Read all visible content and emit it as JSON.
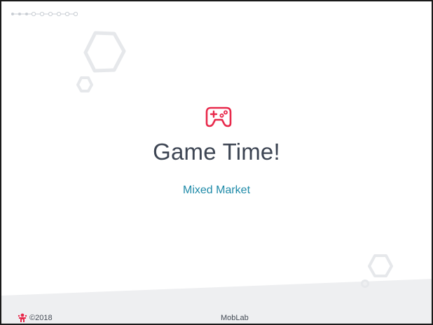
{
  "slide": {
    "title": "Game Time!",
    "subtitle": "Mixed Market"
  },
  "footer": {
    "copyright": "©2018",
    "brand": "MobLab"
  },
  "icons": {
    "main": "game-controller-icon",
    "footer_logo": "moblab-logo-icon"
  },
  "colors": {
    "accent": "#e8294b",
    "title": "#3d4553",
    "subtitle": "#1e8aa8",
    "decoration": "#e6e8eb",
    "footer_band": "#eeeff1"
  }
}
